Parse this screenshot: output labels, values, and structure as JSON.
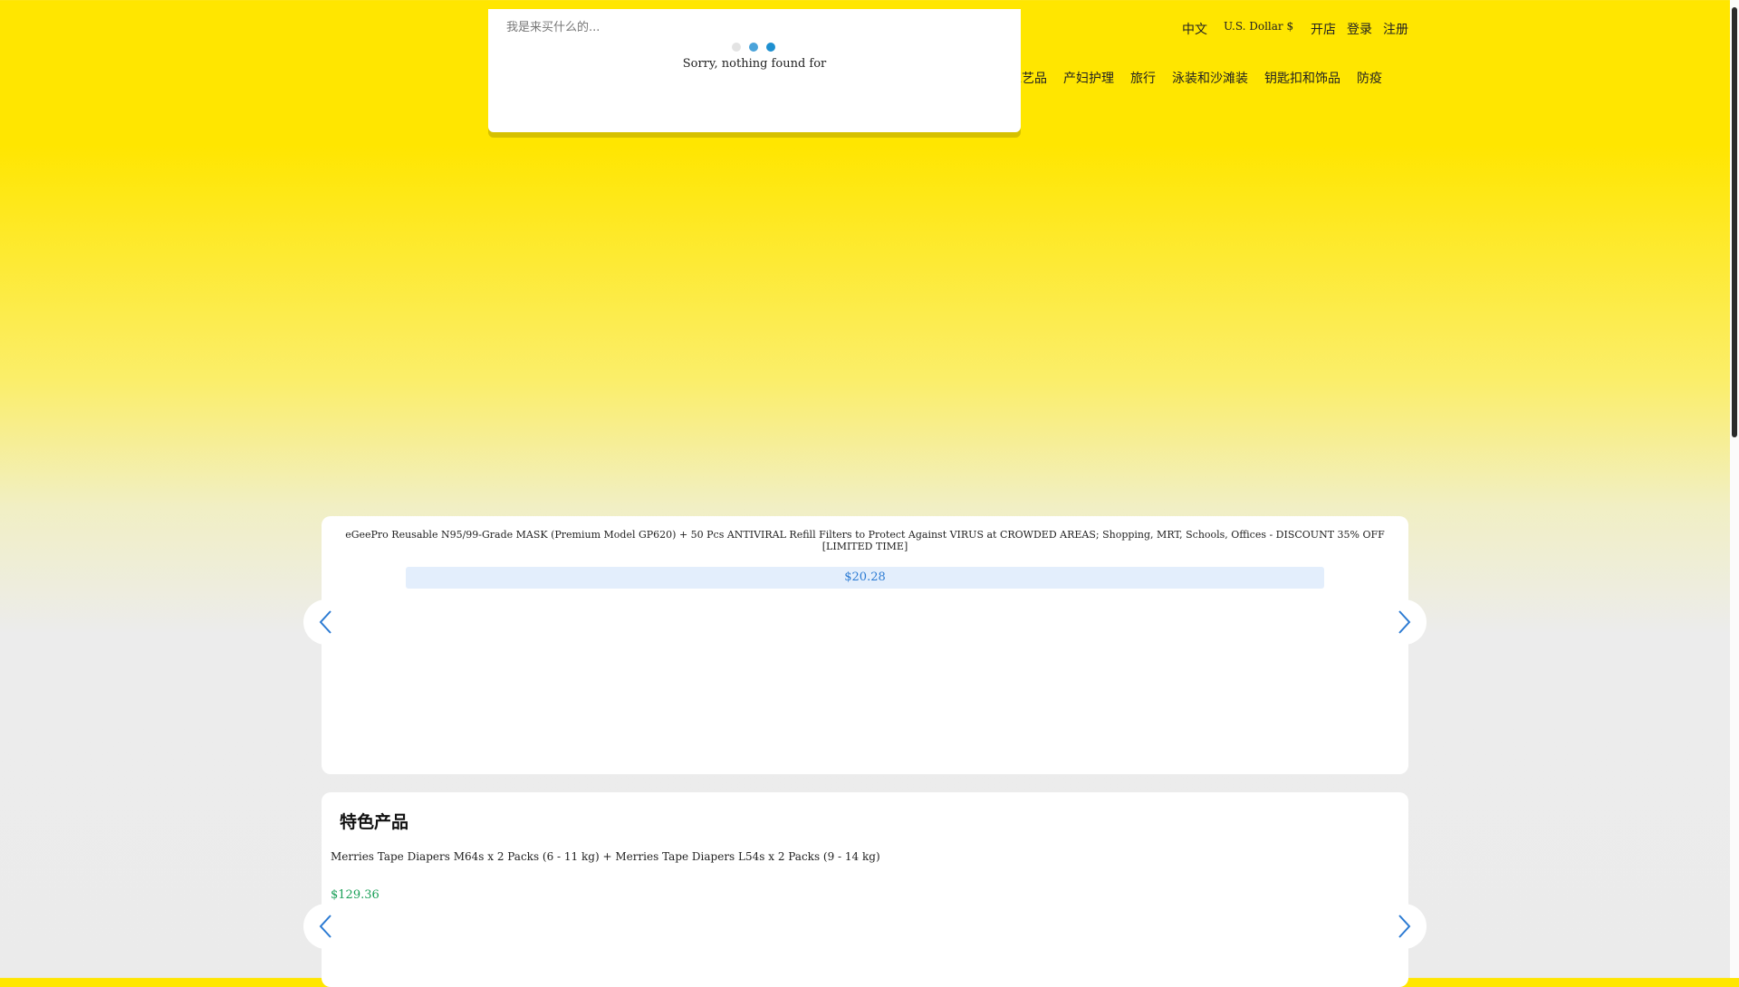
{
  "header": {
    "language": "中文",
    "currency": "U.S. Dollar $",
    "links": [
      "开店",
      "登录",
      "注册"
    ],
    "nav": [
      "艺工艺品",
      "产妇护理",
      "旅行",
      "泳装和沙滩装",
      "钥匙扣和饰品",
      "防疫"
    ]
  },
  "search": {
    "placeholder": "我是来买什么的...",
    "empty_message": "Sorry, nothing found for"
  },
  "carousel": {
    "product_title": "eGeePro Reusable N95/99-Grade MASK (Premium Model GP620) + 50 Pcs ANTIVIRAL Refill Filters to Protect Against VIRUS at CROWDED AREAS; Shopping, MRT, Schools, Offices - DISCOUNT 35% OFF [LIMITED TIME]",
    "price": "$20.28"
  },
  "featured": {
    "title": "特色产品",
    "product_title": "Merries Tape Diapers M64s x 2 Packs (6 - 11 kg) + Merries Tape Diapers L54s x 2 Packs (9 - 14 kg)",
    "price": "$129.36"
  },
  "colors": {
    "brand_yellow": "#ffe600",
    "price_blue": "#2c7bd3",
    "price_green": "#1aa058"
  }
}
